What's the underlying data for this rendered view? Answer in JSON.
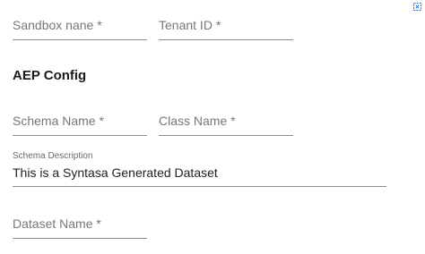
{
  "form": {
    "sandbox_name": {
      "label": "Sandbox nane *",
      "value": ""
    },
    "tenant_id": {
      "label": "Tenant ID *",
      "value": ""
    },
    "section_title": "AEP Config",
    "schema_name": {
      "label": "Schema Name *",
      "value": ""
    },
    "class_name": {
      "label": "Class Name *",
      "value": ""
    },
    "schema_description": {
      "label": "Schema Description",
      "value": "This is a Syntasa Generated Dataset"
    },
    "dataset_name": {
      "label": "Dataset Name *",
      "value": ""
    }
  },
  "colors": {
    "text_primary": "#1f1f1f",
    "text_placeholder": "#777777",
    "underline": "#8f8f8f",
    "corner_icon": "#1a73e8"
  },
  "icons": {
    "corner": "expand-icon"
  }
}
